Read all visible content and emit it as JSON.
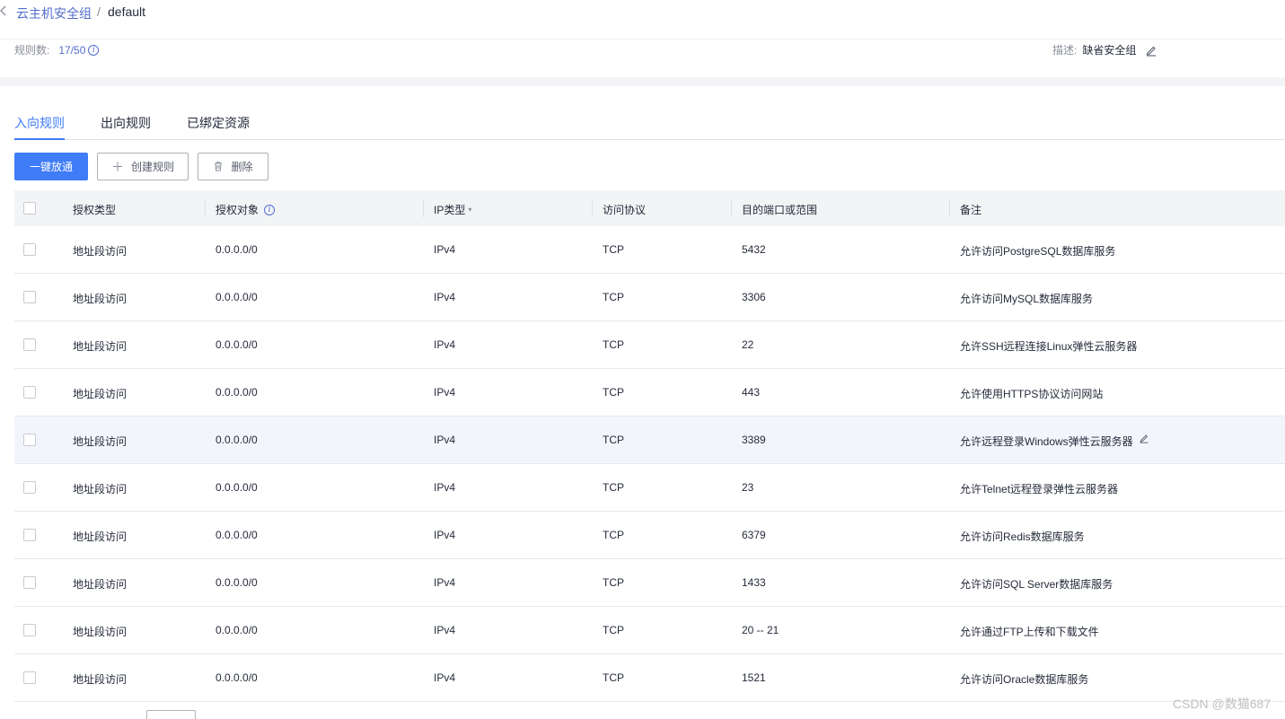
{
  "breadcrumb": {
    "back_icon": "chevron-left-icon",
    "parent": "云主机安全组",
    "separator": "/",
    "current": "default"
  },
  "info": {
    "rule_count_label": "规则数:",
    "rule_count_value": "17/50",
    "description_label": "描述:",
    "description_value": "缺省安全组"
  },
  "tabs": [
    {
      "label": "入向规则",
      "active": true
    },
    {
      "label": "出向规则",
      "active": false
    },
    {
      "label": "已绑定资源",
      "active": false
    }
  ],
  "toolbar": {
    "allow_all_label": "一键放通",
    "create_label": "创建规则",
    "delete_label": "删除"
  },
  "table": {
    "headers": [
      "授权类型",
      "授权对象",
      "IP类型",
      "访问协议",
      "目的端口或范围",
      "备注"
    ],
    "rows": [
      {
        "auth_type": "地址段访问",
        "object": "0.0.0.0/0",
        "ip_type": "IPv4",
        "protocol": "TCP",
        "port": "5432",
        "note": "允许访问PostgreSQL数据库服务"
      },
      {
        "auth_type": "地址段访问",
        "object": "0.0.0.0/0",
        "ip_type": "IPv4",
        "protocol": "TCP",
        "port": "3306",
        "note": "允许访问MySQL数据库服务"
      },
      {
        "auth_type": "地址段访问",
        "object": "0.0.0.0/0",
        "ip_type": "IPv4",
        "protocol": "TCP",
        "port": "22",
        "note": "允许SSH远程连接Linux弹性云服务器"
      },
      {
        "auth_type": "地址段访问",
        "object": "0.0.0.0/0",
        "ip_type": "IPv4",
        "protocol": "TCP",
        "port": "443",
        "note": "允许使用HTTPS协议访问网站"
      },
      {
        "auth_type": "地址段访问",
        "object": "0.0.0.0/0",
        "ip_type": "IPv4",
        "protocol": "TCP",
        "port": "3389",
        "note": "允许远程登录Windows弹性云服务器"
      },
      {
        "auth_type": "地址段访问",
        "object": "0.0.0.0/0",
        "ip_type": "IPv4",
        "protocol": "TCP",
        "port": "23",
        "note": "允许Telnet远程登录弹性云服务器"
      },
      {
        "auth_type": "地址段访问",
        "object": "0.0.0.0/0",
        "ip_type": "IPv4",
        "protocol": "TCP",
        "port": "6379",
        "note": "允许访问Redis数据库服务"
      },
      {
        "auth_type": "地址段访问",
        "object": "0.0.0.0/0",
        "ip_type": "IPv4",
        "protocol": "TCP",
        "port": "1433",
        "note": "允许访问SQL Server数据库服务"
      },
      {
        "auth_type": "地址段访问",
        "object": "0.0.0.0/0",
        "ip_type": "IPv4",
        "protocol": "TCP",
        "port": "20 -- 21",
        "note": "允许通过FTP上传和下载文件"
      },
      {
        "auth_type": "地址段访问",
        "object": "0.0.0.0/0",
        "ip_type": "IPv4",
        "protocol": "TCP",
        "port": "1521",
        "note": "允许访问Oracle数据库服务"
      }
    ]
  },
  "watermark": "CSDN @数猫687",
  "colors": {
    "accent": "#3f7cf7",
    "link": "#526ecc",
    "header_bg": "#f3f4f6",
    "hover_row": "#f2f5fc"
  }
}
